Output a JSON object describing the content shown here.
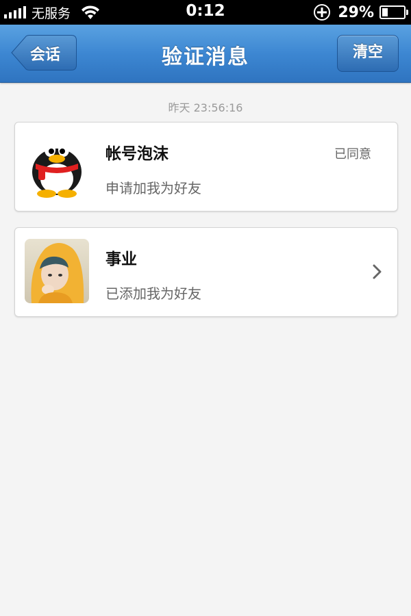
{
  "status_bar": {
    "carrier": "无服务",
    "time": "0:12",
    "battery_percent": "29%",
    "icons": [
      "signal-icon",
      "wifi-icon",
      "orientation-lock-icon",
      "battery-icon"
    ]
  },
  "navbar": {
    "back_label": "会话",
    "title": "验证消息",
    "clear_label": "清空",
    "color": "#3d87d2"
  },
  "date_label": "昨天 23:56:16",
  "messages": [
    {
      "name": "帐号泡沫",
      "text": "申请加我为好友",
      "status": "已同意",
      "avatar": "qq-penguin-avatar"
    },
    {
      "name": "事业",
      "text": "已添加我为好友",
      "status": "",
      "avatar": "child-photo-avatar"
    }
  ]
}
